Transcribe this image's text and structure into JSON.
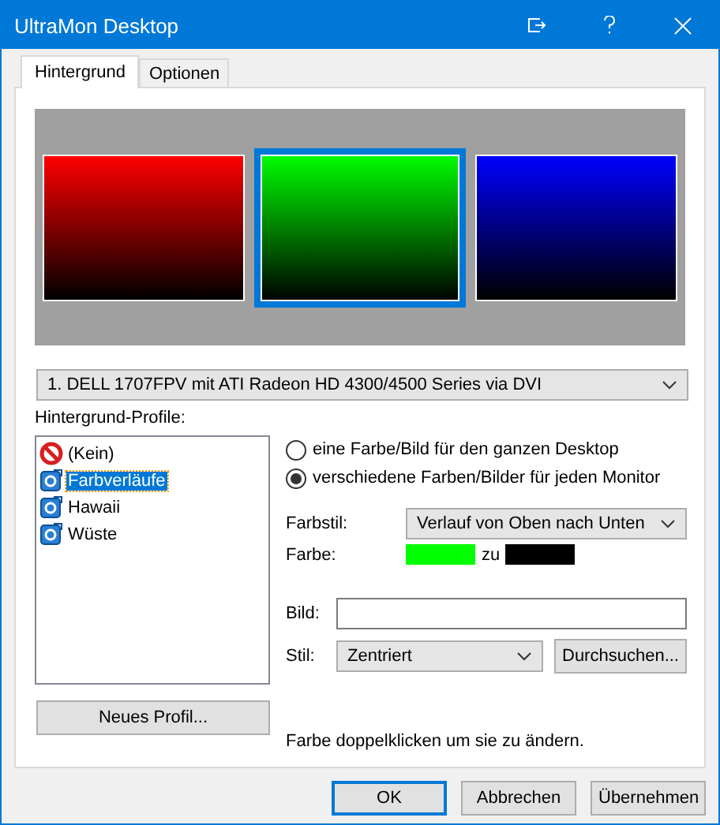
{
  "window": {
    "title": "UltraMon Desktop"
  },
  "tabs": [
    {
      "label": "Hintergrund",
      "selected": true
    },
    {
      "label": "Optionen",
      "selected": false
    }
  ],
  "monitors": [
    {
      "color": "#ff0000",
      "selected": false
    },
    {
      "color": "#00ff00",
      "selected": true
    },
    {
      "color": "#0000ff",
      "selected": false
    }
  ],
  "monitor_select": {
    "value": "1. DELL 1707FPV mit ATI Radeon HD 4300/4500 Series via DVI"
  },
  "profiles": {
    "label": "Hintergrund-Profile:",
    "items": [
      {
        "label": "(Kein)",
        "kind": "none",
        "selected": false
      },
      {
        "label": "Farbverläufe",
        "kind": "profile",
        "selected": true
      },
      {
        "label": "Hawaii",
        "kind": "profile",
        "selected": false
      },
      {
        "label": "Wüste",
        "kind": "profile",
        "selected": false
      }
    ]
  },
  "mode_options": [
    {
      "label": "eine Farbe/Bild für den ganzen Desktop",
      "selected": false
    },
    {
      "label": "verschiedene Farben/Bilder für jeden Monitor",
      "selected": true
    }
  ],
  "color_style": {
    "label": "Farbstil:",
    "value": "Verlauf von Oben nach Unten"
  },
  "color": {
    "label": "Farbe:",
    "swatches": [
      {
        "color": "#00ff00"
      },
      {
        "color": "#000000"
      }
    ],
    "separator": "zu"
  },
  "picture": {
    "label": "Bild:"
  },
  "style": {
    "label": "Stil:",
    "value": "Zentriert"
  },
  "browse_button": "Durchsuchen...",
  "new_profile_button": "Neues Profil...",
  "hint": "Farbe doppelklicken um sie zu ändern.",
  "buttons": [
    {
      "label": "OK",
      "default": true
    },
    {
      "label": "Abbrechen",
      "default": false
    },
    {
      "label": "Übernehmen",
      "default": false
    }
  ]
}
